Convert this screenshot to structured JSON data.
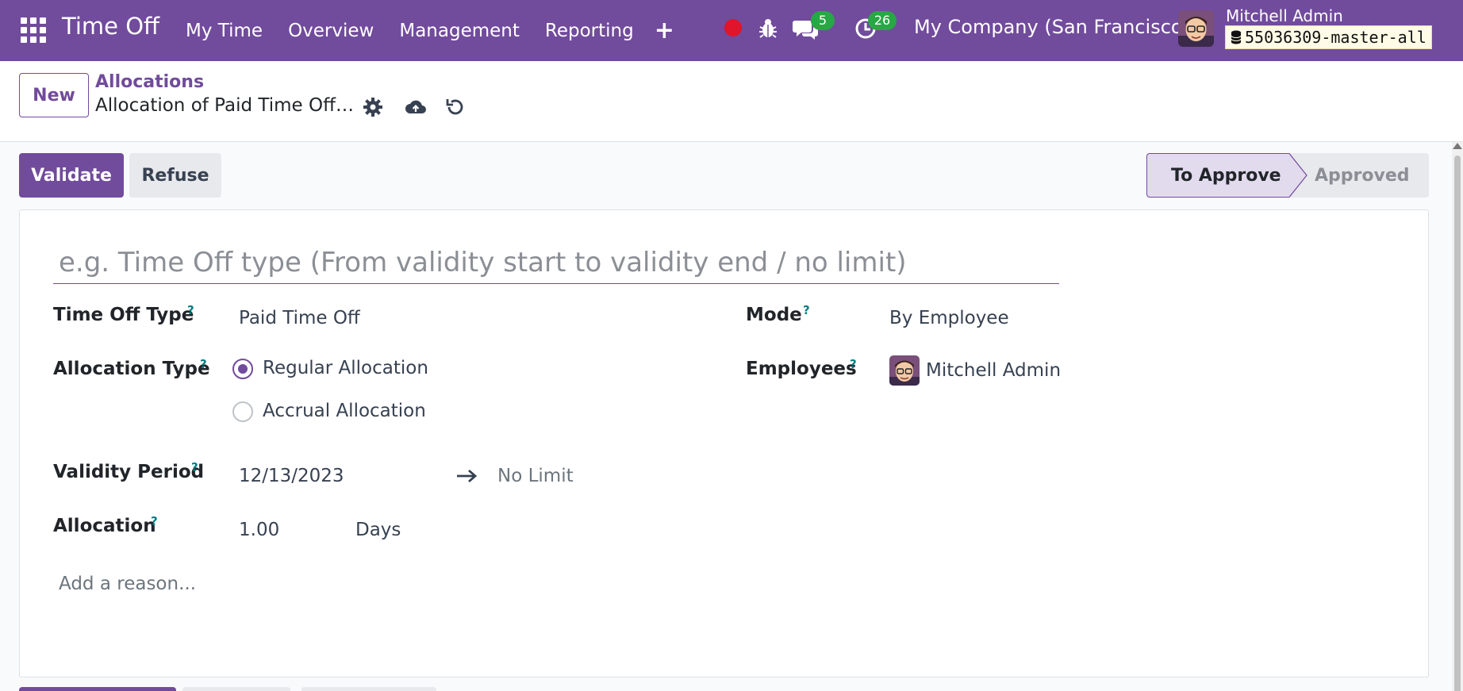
{
  "navbar": {
    "app_title": "Time Off",
    "menu": [
      "My Time",
      "Overview",
      "Management",
      "Reporting"
    ],
    "plus_icon": "+",
    "chat_count": "5",
    "activity_count": "26",
    "company": "My Company (San Francisco)",
    "user_name": "Mitchell Admin",
    "db_name": "55036309-master-all",
    "colors": {
      "bar": "#714b9c",
      "record": "#e0142b",
      "badge": "#28a745"
    }
  },
  "control": {
    "new_label": "New",
    "breadcrumb_parent": "Allocations",
    "breadcrumb_current": "Allocation of Paid Time Off…"
  },
  "status": {
    "validate_label": "Validate",
    "refuse_label": "Refuse",
    "steps": [
      "To Approve",
      "Approved"
    ],
    "active_step": "To Approve"
  },
  "form": {
    "name_placeholder": "e.g. Time Off type (From validity start to validity end / no limit)",
    "time_off_type_label": "Time Off Type",
    "time_off_type_value": "Paid Time Off",
    "allocation_type_label": "Allocation Type",
    "allocation_type_options": [
      "Regular Allocation",
      "Accrual Allocation"
    ],
    "allocation_type_selected": "Regular Allocation",
    "validity_label": "Validity Period",
    "validity_start": "12/13/2023",
    "validity_end_placeholder": "No Limit",
    "allocation_label": "Allocation",
    "allocation_value": "1.00",
    "allocation_unit": "Days",
    "reason_placeholder": "Add a reason...",
    "mode_label": "Mode",
    "mode_value": "By Employee",
    "employees_label": "Employees",
    "employee_name": "Mitchell Admin",
    "help_mark": "?"
  },
  "colors": {
    "accent": "#714b9c",
    "help": "#017e84"
  }
}
